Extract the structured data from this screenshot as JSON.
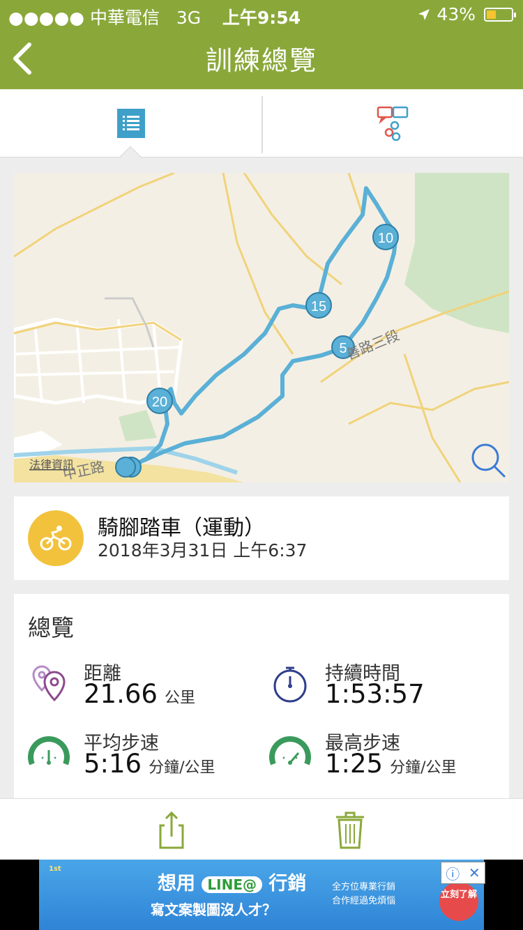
{
  "status_bar": {
    "carrier": "●●●●● 中華電信",
    "network": "3G",
    "time": "上午9:54",
    "battery_percent": "43%",
    "battery_level": 0.43
  },
  "nav": {
    "title": "訓練總覽",
    "back_icon": "chevron-left-icon"
  },
  "tabs": [
    {
      "icon": "list-icon",
      "selected": true
    },
    {
      "icon": "chat-bubbles-icon",
      "selected": false
    }
  ],
  "map": {
    "attribution": "法律資訊",
    "road_labels": [
      "中正路",
      "善路三段"
    ],
    "markers": [
      "5",
      "10",
      "15",
      "20"
    ],
    "zoom_icon": "magnifier-icon"
  },
  "activity": {
    "title": "騎腳踏車（運動）",
    "datetime": "2018年3月31日 上午6:37",
    "icon": "bicycle-icon",
    "color": "#f2c23d"
  },
  "overview": {
    "heading": "總覽",
    "stats": [
      {
        "label": "距離",
        "value": "21.66",
        "unit": "公里",
        "icon": "location-pins-icon"
      },
      {
        "label": "持續時間",
        "value": "1:53:57",
        "unit": "",
        "icon": "stopwatch-icon"
      },
      {
        "label": "平均步速",
        "value": "5:16",
        "unit": "分鐘/公里",
        "icon": "speed-gauge-icon"
      },
      {
        "label": "最高步速",
        "value": "1:25",
        "unit": "分鐘/公里",
        "icon": "speed-gauge-icon"
      }
    ]
  },
  "toolbar": {
    "share_icon": "share-icon",
    "delete_icon": "trash-icon"
  },
  "ad": {
    "line1_a": "想用",
    "line1_line": "LINE@",
    "line1_b": "行銷",
    "line2": "寫文案製圖沒人才？",
    "right1": "全方位專業行銷",
    "right2": "合作經過免煩惱",
    "cta": "立刻了解",
    "info_icon": "info-icon",
    "close_icon": "close-icon"
  },
  "colors": {
    "header": "#8aa83a",
    "route": "#5ab0d6",
    "accent": "#3ea0c9"
  }
}
